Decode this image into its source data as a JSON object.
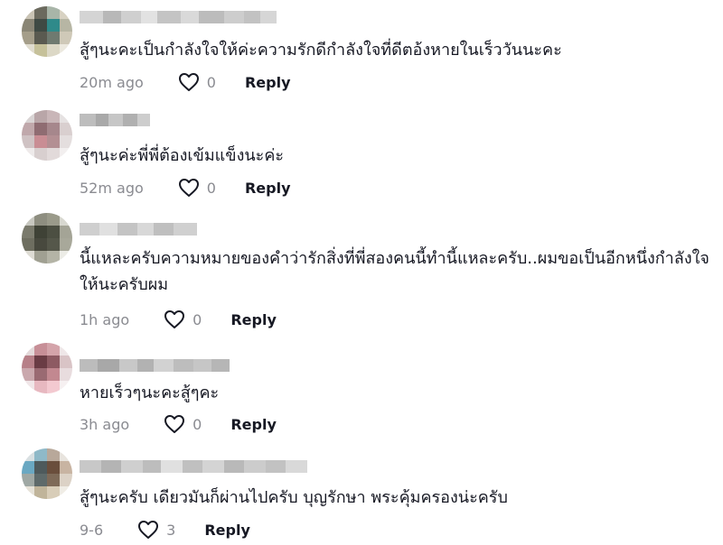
{
  "comments": [
    {
      "text": "สู้ๆนะคะเป็นกำลังใจให้ค่ะความรักดีกำลังใจที่ดีตอ้งหายในเร็ววันนะคะ",
      "time": "20m ago",
      "likes": "0",
      "reply": "Reply"
    },
    {
      "text": "สู้ๆนะค่ะพี่พี่ต้องเข้มแข็งนะค่ะ",
      "time": "52m ago",
      "likes": "0",
      "reply": "Reply"
    },
    {
      "text": "นี้แหละครับความหมายของคำว่ารักสิ่งที่พี่สองคนนี้ทำนี้แหละครับ..ผมขอเป็นอีกหนึ่งกำลังใจให้นะครับผม",
      "time": "1h ago",
      "likes": "0",
      "reply": "Reply"
    },
    {
      "text": "หายเร็วๆนะคะสู้ๆคะ",
      "time": "3h ago",
      "likes": "0",
      "reply": "Reply"
    },
    {
      "text": "สู้ๆนะครับ เดียวมันก็ผ่านไปครับ บุญรักษา พระคุ้มครองน่ะครับ",
      "time": "9-6",
      "likes": "3",
      "reply": "Reply"
    }
  ],
  "icons": {
    "like": "heart-outline-icon"
  },
  "colors": {
    "text": "#161823",
    "muted": "#8a8b91"
  }
}
